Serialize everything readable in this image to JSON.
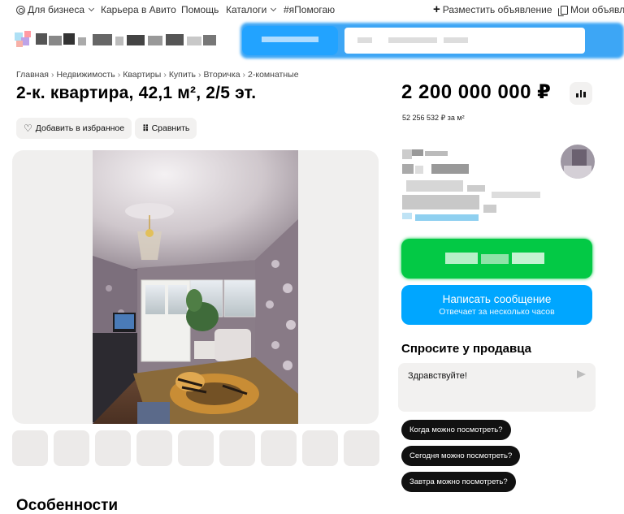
{
  "topnav": {
    "business": "Для бизнеса",
    "career": "Карьера в Авито",
    "help": "Помощь",
    "catalogs": "Каталоги",
    "help_tag": "#яПомогаю",
    "post_ad": "Разместить объявление",
    "my_ads": "Мои объявле"
  },
  "breadcrumb": [
    "Главная",
    "Недвижимость",
    "Квартиры",
    "Купить",
    "Вторичка",
    "2-комнатные"
  ],
  "breadcrumb_sep": "›",
  "listing": {
    "title": "2-к. квартира, 42,1 м², 2/5 эт.",
    "price": "2 200 000 000 ₽",
    "price_per_m2": "52 256 532 ₽ за м²"
  },
  "actions": {
    "favorite": "Добавить в избранное",
    "compare": "Сравнить"
  },
  "contact": {
    "message_button": "Написать сообщение",
    "message_sub": "Отвечает за несколько часов"
  },
  "ask_seller": {
    "title": "Спросите у продавца",
    "input_value": "Здравствуйте!",
    "chips": [
      "Когда можно посмотреть?",
      "Сегодня можно посмотреть?",
      "Завтра можно посмотреть?"
    ]
  },
  "sections": {
    "features": "Особенности"
  },
  "thumbnail_count": 9,
  "icons": [
    "globe-icon",
    "chevron-down-icon",
    "plus-icon",
    "document-icon",
    "heart-icon",
    "compare-icon",
    "bar-chart-icon",
    "send-icon"
  ],
  "colors": {
    "call_green": "#03c945",
    "message_blue": "#00a6ff",
    "search_blue": "#3da6f5",
    "chip_bg": "#111111",
    "button_gray": "#f2f1f0"
  }
}
